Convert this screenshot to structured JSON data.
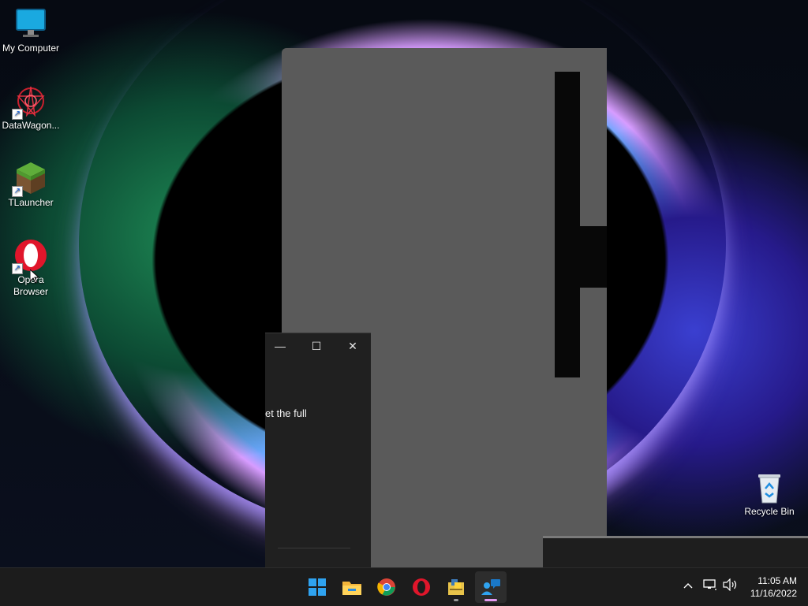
{
  "desktop": {
    "icons": [
      {
        "label": "My Computer"
      },
      {
        "label": "DataWagon..."
      },
      {
        "label": "TLauncher"
      },
      {
        "label": "Opera Browser"
      },
      {
        "label": "Recycle Bin"
      }
    ],
    "shortcut_arrow": "↗"
  },
  "window": {
    "minimize_glyph": "—",
    "maximize_glyph": "☐",
    "close_glyph": "✕",
    "message": "et the full"
  },
  "taskbar": {
    "apps": [
      {
        "name": "start-icon"
      },
      {
        "name": "file-explorer-icon"
      },
      {
        "name": "chrome-icon"
      },
      {
        "name": "opera-icon"
      },
      {
        "name": "python-installer-icon"
      },
      {
        "name": "support-app-icon"
      }
    ],
    "tray": {
      "chevron": "^",
      "time": "11:05 AM",
      "date": "11/16/2022"
    }
  },
  "colors": {
    "accent": "#e49af2",
    "taskbar": "#1c1c1c",
    "window": "#202020"
  }
}
